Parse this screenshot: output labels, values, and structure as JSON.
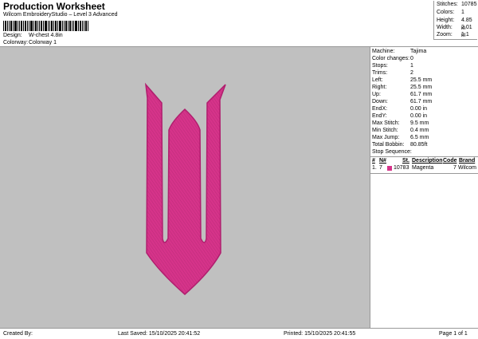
{
  "header": {
    "title": "Production Worksheet",
    "subtitle": "Wilcom EmbroideryStudio – Level 3 Advanced",
    "design_label": "Design:",
    "design_value": "W-chest 4.8in",
    "colorway_label": "Colorway:",
    "colorway_value": "Colorway 1"
  },
  "stats": [
    {
      "label": "Stitches:",
      "value": "10785"
    },
    {
      "label": "Colors:",
      "value": "1"
    },
    {
      "label": "Height:",
      "value": "4.85 in"
    },
    {
      "label": "Width:",
      "value": "2.01 in"
    },
    {
      "label": "Zoom:",
      "value": "1:1"
    }
  ],
  "machine": [
    {
      "label": "Machine:",
      "value": "Tajima"
    },
    {
      "label": "Color changes:",
      "value": "0"
    },
    {
      "label": "Stops:",
      "value": "1"
    },
    {
      "label": "Trims:",
      "value": "2"
    },
    {
      "label": "Left:",
      "value": "25.5 mm"
    },
    {
      "label": "Right:",
      "value": "25.5 mm"
    },
    {
      "label": "Up:",
      "value": "61.7 mm"
    },
    {
      "label": "Down:",
      "value": "61.7 mm"
    },
    {
      "label": "EndX:",
      "value": "0.00 in"
    },
    {
      "label": "EndY:",
      "value": "0.00 in"
    },
    {
      "label": "Max Stitch:",
      "value": "9.5 mm"
    },
    {
      "label": "Min Stitch:",
      "value": "0.4 mm"
    },
    {
      "label": "Max Jump:",
      "value": "6.5 mm"
    },
    {
      "label": "Total Bobbin:",
      "value": "80.85ft"
    }
  ],
  "sequence": {
    "title": "Stop Sequence:",
    "headers": {
      "n": "#",
      "no": "N#",
      "st": "St.",
      "desc": "Description",
      "code": "Code",
      "brand": "Brand"
    },
    "rows": [
      {
        "n": "1.",
        "no": "7",
        "st": "10783",
        "desc": "Magenta",
        "code": "7",
        "brand": "Wilcom",
        "color": "#d6338a"
      }
    ]
  },
  "design_color": "#d6338a",
  "canvas_color": "#c0c0c0",
  "footer": {
    "created_by": "Created By:",
    "last_saved": "Last Saved: 15/10/2025 20:41:52",
    "printed": "Printed: 15/10/2025 20:41:55",
    "page": "Page 1 of 1"
  }
}
